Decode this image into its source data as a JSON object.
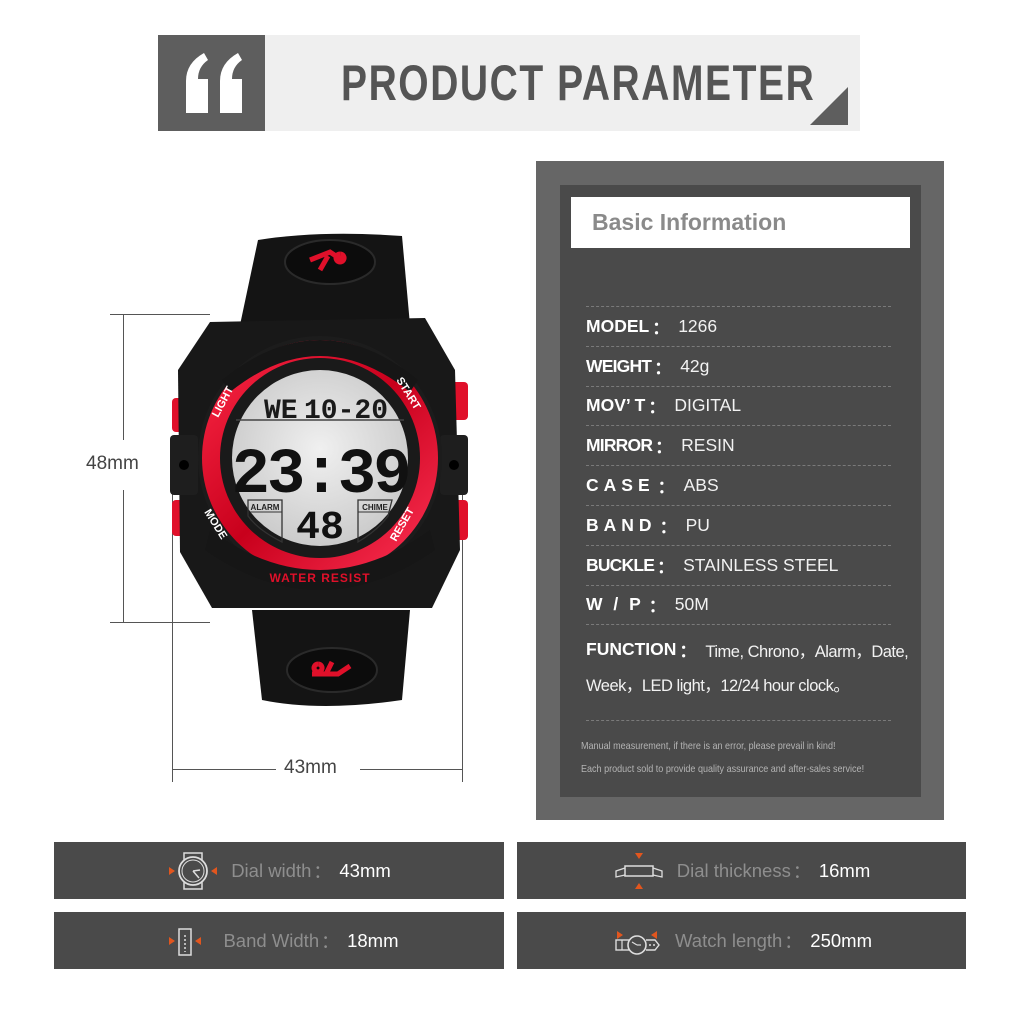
{
  "header": {
    "title": "PRODUCT PARAMETER",
    "quote_icon": "double-quote-icon"
  },
  "watch": {
    "lcd": {
      "day": "WE",
      "date": "10-20",
      "time": "23:39",
      "seconds": "48",
      "left_label": "ALARM",
      "right_label": "CHIME"
    },
    "bezel_labels": {
      "top_left": "LIGHT",
      "top_right": "START",
      "bottom_left": "MODE",
      "bottom_right": "RESET",
      "bottom": "WATER RESIST"
    },
    "dimensions": {
      "height": "48mm",
      "width": "43mm"
    },
    "colors": {
      "accent": "#e0102a",
      "body": "#151515",
      "lcd": "#d8d8d8"
    }
  },
  "basic_info": {
    "title": "Basic Information",
    "specs": [
      {
        "key": "MODEL",
        "value": "1266"
      },
      {
        "key": "WEIGHT",
        "value": "42g"
      },
      {
        "key": "MOV’ T",
        "value": "DIGITAL"
      },
      {
        "key": "MIRROR",
        "value": "RESIN"
      },
      {
        "key": "CASE",
        "value": "ABS"
      },
      {
        "key": "BAND",
        "value": "PU"
      },
      {
        "key": "BUCKLE",
        "value": "STAINLESS STEEL"
      },
      {
        "key": "W / P",
        "value": "50M"
      }
    ],
    "function": {
      "key": "FUNCTION",
      "line1": "Time, Chrono，Alarm，Date,",
      "line2": "Week，LED light，12/24 hour clock。"
    },
    "notes": [
      "Manual measurement, if there is an error, please prevail in kind!",
      "Each product sold to provide quality assurance and after-sales service!"
    ],
    "colon": "："
  },
  "dimension_bars": [
    {
      "icon": "dial-width-icon",
      "label": "Dial width",
      "value": "43mm"
    },
    {
      "icon": "dial-thickness-icon",
      "label": "Dial thickness",
      "value": "16mm"
    },
    {
      "icon": "band-width-icon",
      "label": "Band Width",
      "value": "18mm"
    },
    {
      "icon": "watch-length-icon",
      "label": "Watch length",
      "value": "250mm"
    }
  ],
  "colors": {
    "arrow_accent": "#e2561e",
    "panel_dark": "#4a4a4a",
    "panel_mid": "#666666"
  }
}
